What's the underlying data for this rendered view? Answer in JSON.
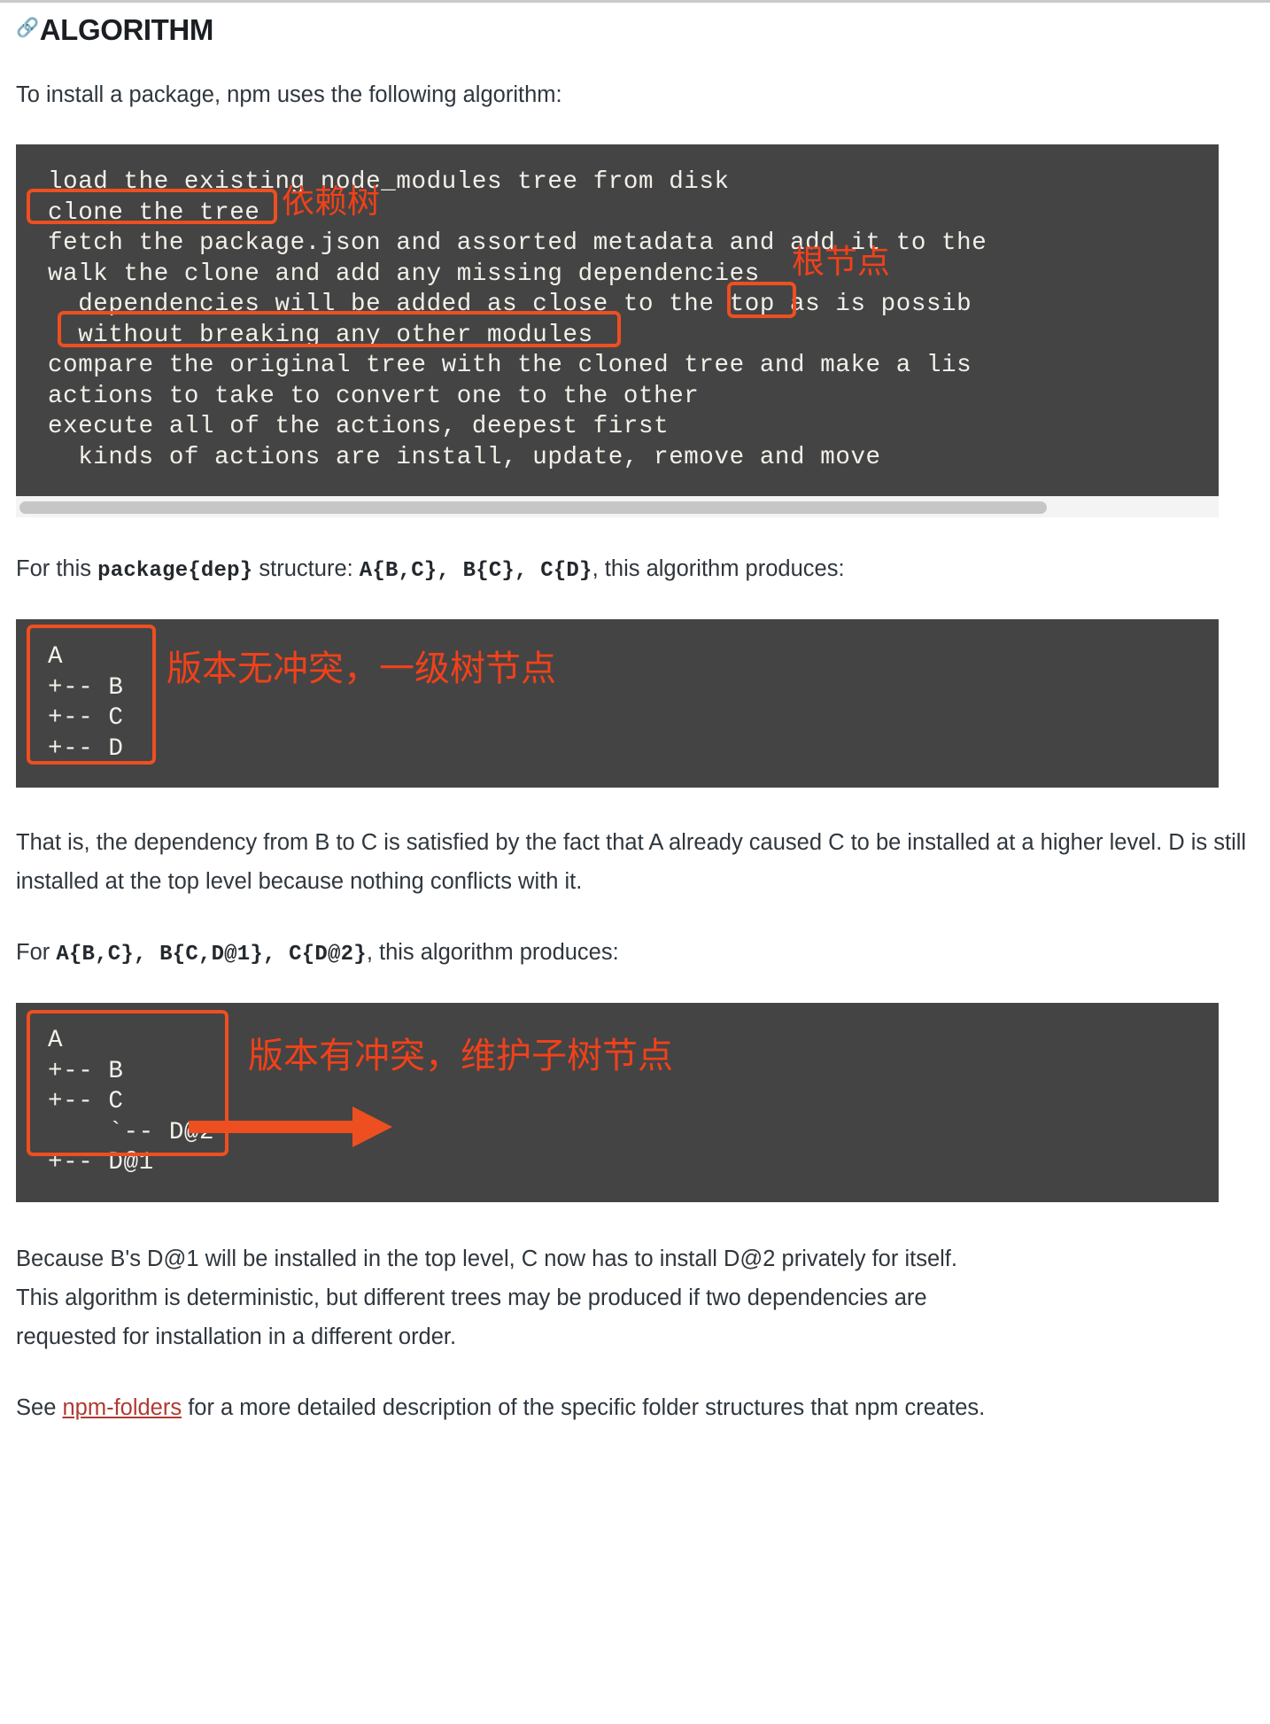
{
  "heading": {
    "anchor_icon": "link-icon",
    "text": "ALGORITHM"
  },
  "intro_paragraph": "To install a package, npm uses the following algorithm:",
  "code_block_algorithm": {
    "lines": [
      "load the existing node_modules tree from disk",
      "clone the tree",
      "fetch the package.json and assorted metadata and add it to the",
      "walk the clone and add any missing dependencies",
      "  dependencies will be added as close to the top as is possib",
      "  without breaking any other modules",
      "compare the original tree with the cloned tree and make a lis",
      "actions to take to convert one to the other",
      "execute all of the actions, deepest first",
      "  kinds of actions are install, update, remove and move"
    ],
    "annotations": [
      {
        "label": "依赖树",
        "target": "clone the tree"
      },
      {
        "label": "根节点",
        "target": "top"
      }
    ]
  },
  "structure_paragraph": {
    "prefix": "For this ",
    "code1": "package{dep}",
    "middle": " structure: ",
    "code2": "A{B,C}, B{C}, C{D}",
    "suffix": ", this algorithm produces:"
  },
  "code_block_tree1": {
    "lines": [
      "A",
      "+-- B",
      "+-- C",
      "+-- D"
    ],
    "annotation": "版本无冲突，一级树节点"
  },
  "explanation_paragraph": "That is, the dependency from B to C is satisfied by the fact that A already caused C to be installed at a higher level. D is still installed at the top level because nothing conflicts with it.",
  "conflict_paragraph": {
    "prefix": "For ",
    "code": "A{B,C}, B{C,D@1}, C{D@2}",
    "suffix": ", this algorithm produces:"
  },
  "code_block_tree2": {
    "lines": [
      "A",
      "+-- B",
      "+-- C",
      "    `-- D@2",
      "+-- D@1"
    ],
    "annotation": "版本有冲突，维护子树节点"
  },
  "conclusion_paragraph": "Because B's D@1 will be installed in the top level, C now has to install D@2 privately for itself. This algorithm is deterministic, but different trees may be produced if two dependencies are requested for installation in a different order.",
  "see_also": {
    "prefix": "See ",
    "link_text": "npm-folders",
    "suffix": " for a more detailed description of the specific folder structures that npm creates."
  },
  "colors": {
    "code_background": "#444444",
    "code_text": "#f3f0ea",
    "annotation_red": "#ee4f20",
    "link": "#b03a32",
    "scrollbar_thumb": "#c6c6c6"
  }
}
